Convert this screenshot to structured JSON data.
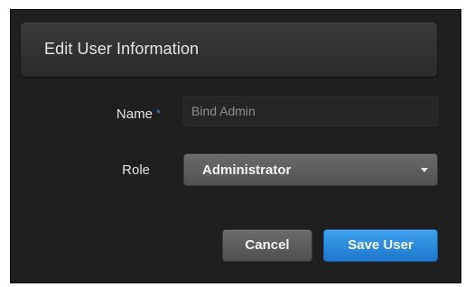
{
  "dialog": {
    "title": "Edit User Information"
  },
  "form": {
    "name_label": "Name",
    "required_marker": "*",
    "name_value": "Bind Admin",
    "role_label": "Role",
    "role_selected": "Administrator"
  },
  "actions": {
    "cancel_label": "Cancel",
    "save_label": "Save User"
  },
  "icons": {
    "role_dropdown": "caret-down-icon"
  },
  "colors": {
    "accent": "#2a8fe0",
    "save_button": "#2b8be0",
    "background": "#1f1f1f"
  }
}
